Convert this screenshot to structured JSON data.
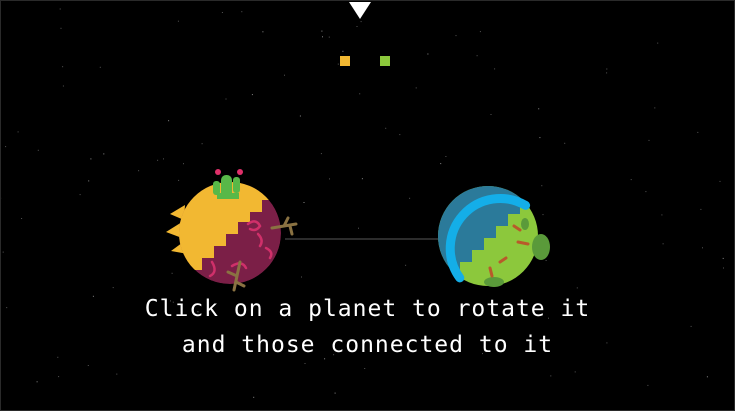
{
  "instructions": {
    "line1": "Click on a planet to rotate it",
    "line2": "and those connected to it"
  },
  "planets": [
    {
      "name": "desert-planet",
      "colors": {
        "sand": "#f2b832",
        "soil": "#7b1f47",
        "cactus": "#58b848",
        "flower": "#e0306a"
      }
    },
    {
      "name": "ocean-planet",
      "colors": {
        "ring": "#14aee8",
        "water": "#2b7a9a",
        "land": "#8cc83c",
        "bush": "#5a9a3a"
      }
    }
  ],
  "indicators": {
    "yellow": "#f2b832",
    "green": "#8cc83c"
  },
  "colors": {
    "background": "#000000",
    "text": "#ffffff",
    "connector": "#3a3a3a"
  }
}
